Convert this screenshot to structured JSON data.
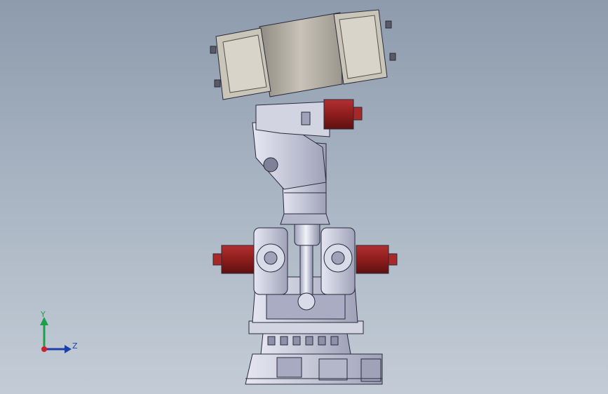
{
  "viewport": {
    "background_top": "#8e9bac",
    "background_bottom": "#c3ccd6"
  },
  "triad": {
    "y_label": "Y",
    "z_label": "Z",
    "y_color": "#1ea04b",
    "z_color": "#1c3fa8",
    "origin_color": "#d0202a"
  },
  "model": {
    "body_color": "#c7c9d8",
    "motor_color": "#8e1d1d",
    "tool_color": "#b9b4a8"
  }
}
